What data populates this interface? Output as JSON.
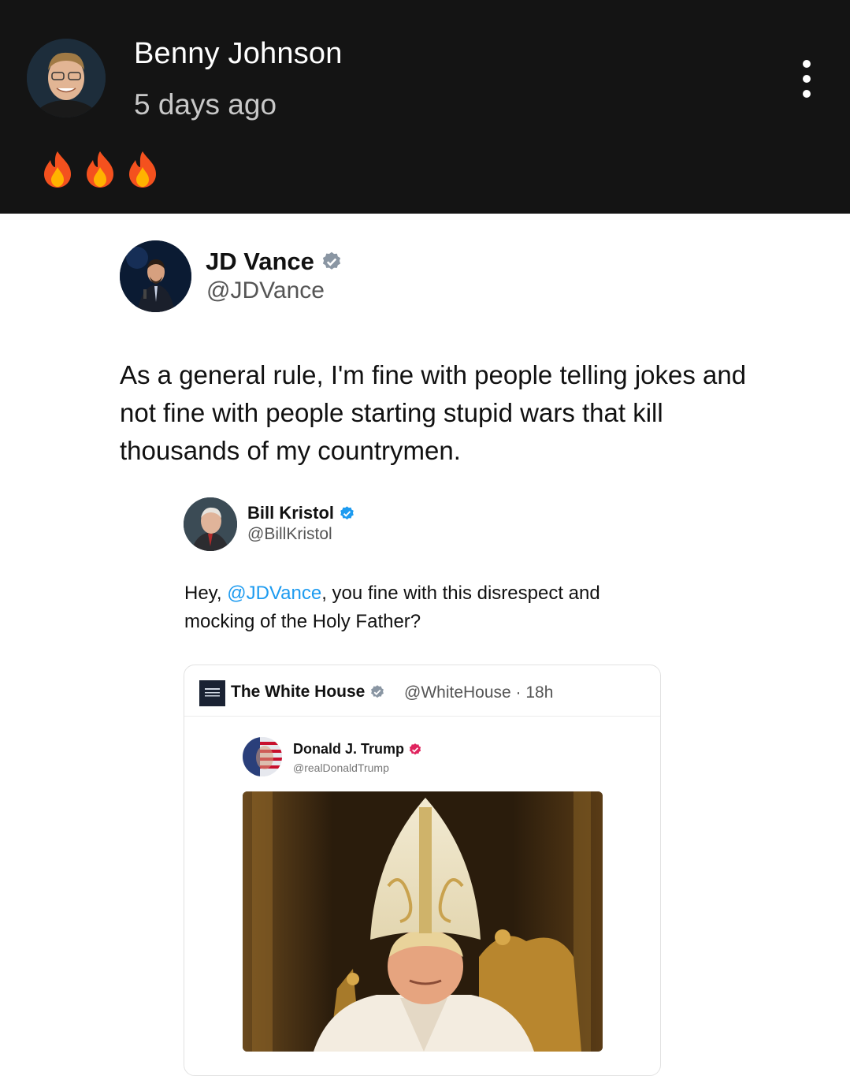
{
  "post": {
    "author": "Benny Johnson",
    "time": "5 days ago",
    "emojis": [
      "fire-emoji",
      "fire-emoji",
      "fire-emoji"
    ],
    "menu_icon": "more-vertical-icon"
  },
  "tweet": {
    "name": "JD Vance",
    "handle": "@JDVance",
    "text": "As a general rule, I'm fine with people telling jokes and not fine with people starting stupid wars that kill thousands of my countrymen.",
    "verified_color": "#8a96a3"
  },
  "quote": {
    "name": "Bill Kristol",
    "handle": "@BillKristol",
    "text_before": "Hey, ",
    "mention": "@JDVance",
    "text_after": ", you fine with this disrespect and mocking of the Holy Father?",
    "verified_color": "#1d9bf0",
    "mention_color": "#1d9bf0"
  },
  "embedded": {
    "name": "The White House",
    "handle_time": "@WhiteHouse · 18h",
    "verified_color": "#8a96a3",
    "inner": {
      "name": "Donald J. Trump",
      "handle": "@realDonaldTrump",
      "verified_color": "#e0245e"
    },
    "image": "pope-image"
  }
}
